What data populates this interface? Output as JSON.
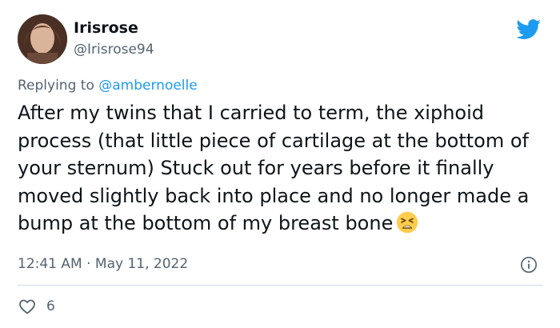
{
  "author": {
    "display_name": "Irisrose",
    "handle": "@Irisrose94"
  },
  "reply": {
    "prefix": "Replying to ",
    "mention": "@ambernoelle"
  },
  "tweet": {
    "text": "After my twins that I carried to term, the xiphoid process (that little piece of cartilage at the bottom of your sternum) Stuck out for years before it finally moved slightly back into place and no longer made a bump at the bottom of my breast bone",
    "emoji": "tired-face-emoji"
  },
  "meta": {
    "time": "12:41 AM",
    "separator": " · ",
    "date": "May 11, 2022"
  },
  "engagement": {
    "likes": "6"
  },
  "icons": {
    "logo": "twitter-bird-icon",
    "info": "info-icon",
    "like": "heart-icon"
  },
  "colors": {
    "brand": "#1d9bf0",
    "secondary_text": "#536471",
    "primary_text": "#0f1419",
    "divider": "#cfd9de"
  }
}
